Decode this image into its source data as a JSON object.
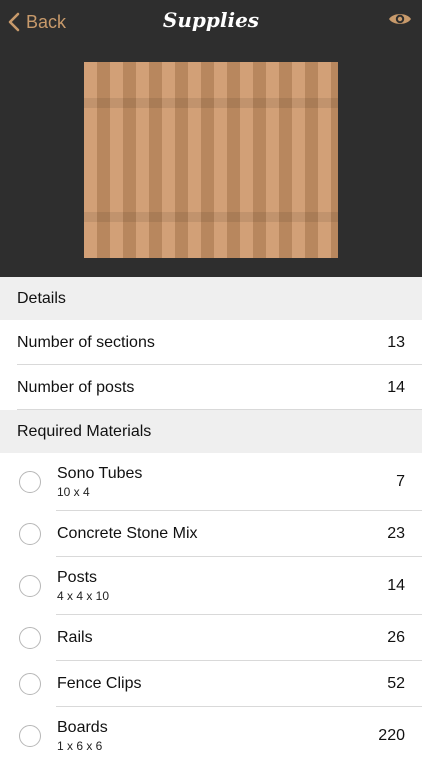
{
  "nav": {
    "back_label": "Back",
    "title": "Supplies",
    "accent_color": "#c89a6b"
  },
  "details": {
    "header": "Details",
    "rows": [
      {
        "label": "Number of sections",
        "value": "13"
      },
      {
        "label": "Number of posts",
        "value": "14"
      }
    ]
  },
  "materials": {
    "header": "Required Materials",
    "items": [
      {
        "name": "Sono Tubes",
        "sub": "10 x 4",
        "value": "7"
      },
      {
        "name": "Concrete Stone Mix",
        "sub": "",
        "value": "23"
      },
      {
        "name": "Posts",
        "sub": "4 x 4 x 10",
        "value": "14"
      },
      {
        "name": "Rails",
        "sub": "",
        "value": "26"
      },
      {
        "name": "Fence Clips",
        "sub": "",
        "value": "52"
      },
      {
        "name": "Boards",
        "sub": "1 x 6 x 6",
        "value": "220"
      }
    ]
  }
}
